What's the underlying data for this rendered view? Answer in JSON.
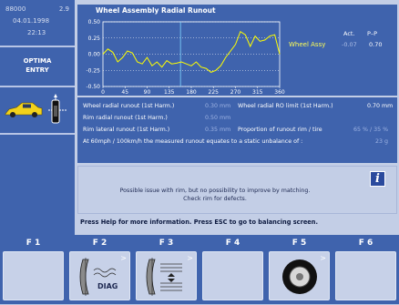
{
  "status": {
    "id": "88000",
    "version": "2.9",
    "date": "04.01.1998",
    "time": "22:13"
  },
  "mode": {
    "line1": "OPTIMA",
    "line2": "ENTRY"
  },
  "graph": {
    "title": "Wheel Assembly Radial Runout",
    "y_ticks": [
      "0.50",
      "0.25",
      "0.00",
      "-0.25",
      "-0.50"
    ],
    "x_ticks": [
      "0",
      "45",
      "90",
      "135",
      "180",
      "225",
      "270",
      "315",
      "360"
    ],
    "legend_label": "Wheel Assy",
    "col_act": "Act.",
    "col_pp": "P–P",
    "act_value": "-0.07",
    "pp_value": "0.70"
  },
  "chart_data": {
    "type": "line",
    "x": [
      0,
      10,
      20,
      30,
      40,
      50,
      60,
      70,
      80,
      90,
      100,
      110,
      120,
      130,
      140,
      150,
      160,
      170,
      180,
      190,
      200,
      210,
      220,
      230,
      240,
      250,
      260,
      270,
      280,
      290,
      300,
      310,
      320,
      330,
      340,
      350
    ],
    "y": [
      0.0,
      0.08,
      0.03,
      -0.12,
      -0.05,
      0.05,
      0.02,
      -0.12,
      -0.15,
      -0.05,
      -0.18,
      -0.12,
      -0.2,
      -0.1,
      -0.15,
      -0.14,
      -0.12,
      -0.15,
      -0.18,
      -0.12,
      -0.2,
      -0.22,
      -0.28,
      -0.25,
      -0.18,
      -0.05,
      0.05,
      0.15,
      0.35,
      0.3,
      0.12,
      0.28,
      0.2,
      0.22,
      0.28,
      0.3
    ],
    "xlim": [
      0,
      360
    ],
    "ylim": [
      -0.5,
      0.5
    ],
    "marker_x": 158,
    "grid": true
  },
  "data": {
    "r1_label": "Wheel radial runout (1st Harm.)",
    "r1_value": "0.30 mm",
    "r1b_label": "Wheel radial RO limit (1st Harm.)",
    "r1b_value": "0.70 mm",
    "r2_label": "Rim radial runout (1st Harm.)",
    "r2_value": "0.50 mm",
    "r3_label": "Rim lateral runout (1st Harm.)",
    "r3_value": "0.35 mm",
    "r3b_label": "Proportion of runout rim / tire",
    "r3b_value": "65 % / 35 %",
    "r4_label": "At 60mph / 100km/h the measured runout equates to a static unbalance of :",
    "r4_value": "23 g"
  },
  "message": {
    "line1": "Possible issue with rim, but no possibility to improve by matching.",
    "line2": "Check rim for defects."
  },
  "help": "Press Help for more information. Press ESC to go to balancing screen.",
  "fkeys": [
    "F 1",
    "F 2",
    "F 3",
    "F 4",
    "F 5",
    "F 6"
  ],
  "fkey_diag_label": "DIAG",
  "colors": {
    "panel": "#3f63ad",
    "curve": "#ffff00",
    "marker": "#7fd6ff"
  }
}
